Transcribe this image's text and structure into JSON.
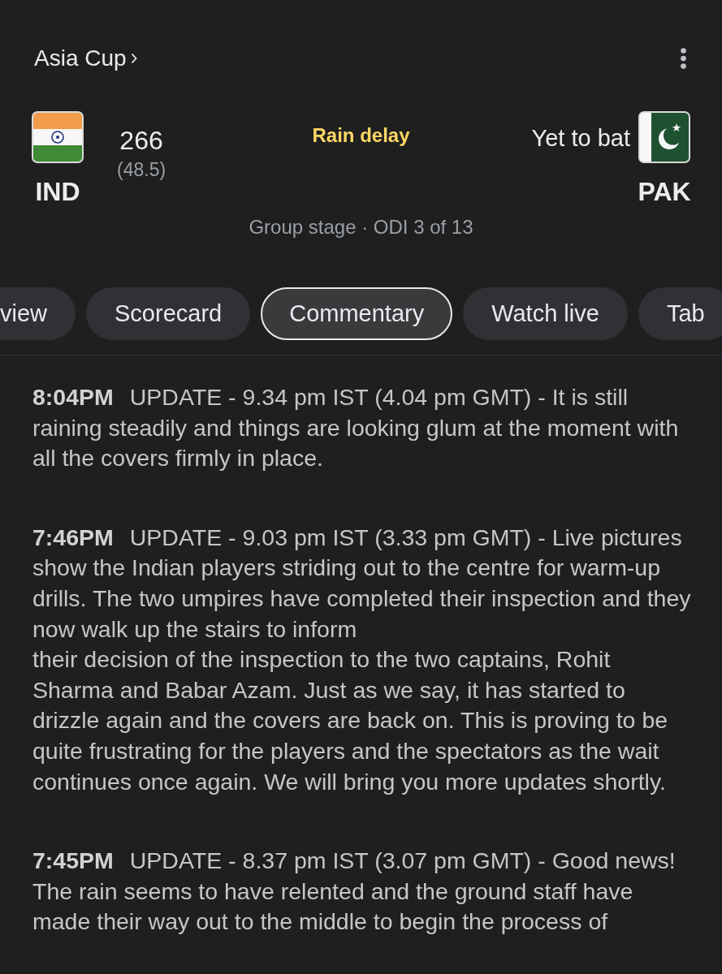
{
  "header": {
    "competition": "Asia Cup"
  },
  "match": {
    "status": "Rain delay",
    "teams": [
      {
        "name": "IND",
        "kind": "india",
        "score": "266",
        "overs": "(48.5)"
      },
      {
        "name": "PAK",
        "kind": "pakistan",
        "note": "Yet to bat"
      }
    ],
    "stage": "Group stage · ODI 3 of 13"
  },
  "tabs": [
    {
      "label": "view",
      "selected": false
    },
    {
      "label": "Scorecard",
      "selected": false
    },
    {
      "label": "Commentary",
      "selected": true
    },
    {
      "label": "Watch live",
      "selected": false
    },
    {
      "label": "Tab",
      "selected": false
    }
  ],
  "commentary": [
    {
      "time": "8:04PM",
      "text": "UPDATE - 9.34 pm IST (4.04 pm GMT) - It is still raining steadily and things are looking glum at the moment with all the covers firmly in place."
    },
    {
      "time": "7:46PM",
      "text": "UPDATE - 9.03 pm IST (3.33 pm GMT) - Live pictures show the Indian players striding out to the centre for warm-up drills. The two umpires have completed their inspection and they now walk up the stairs to inform\ntheir decision of the inspection to the two captains, Rohit Sharma and Babar Azam. Just as we say, it has started to drizzle again and the covers are back on. This is proving to be quite frustrating for the players and the spectators as the wait continues once again. We will bring you more updates shortly."
    },
    {
      "time": "7:45PM",
      "text": "UPDATE - 8.37 pm IST (3.07 pm GMT) - Good news! The rain seems to have relented and the ground staff have made their way out to the middle to begin the process of"
    }
  ]
}
